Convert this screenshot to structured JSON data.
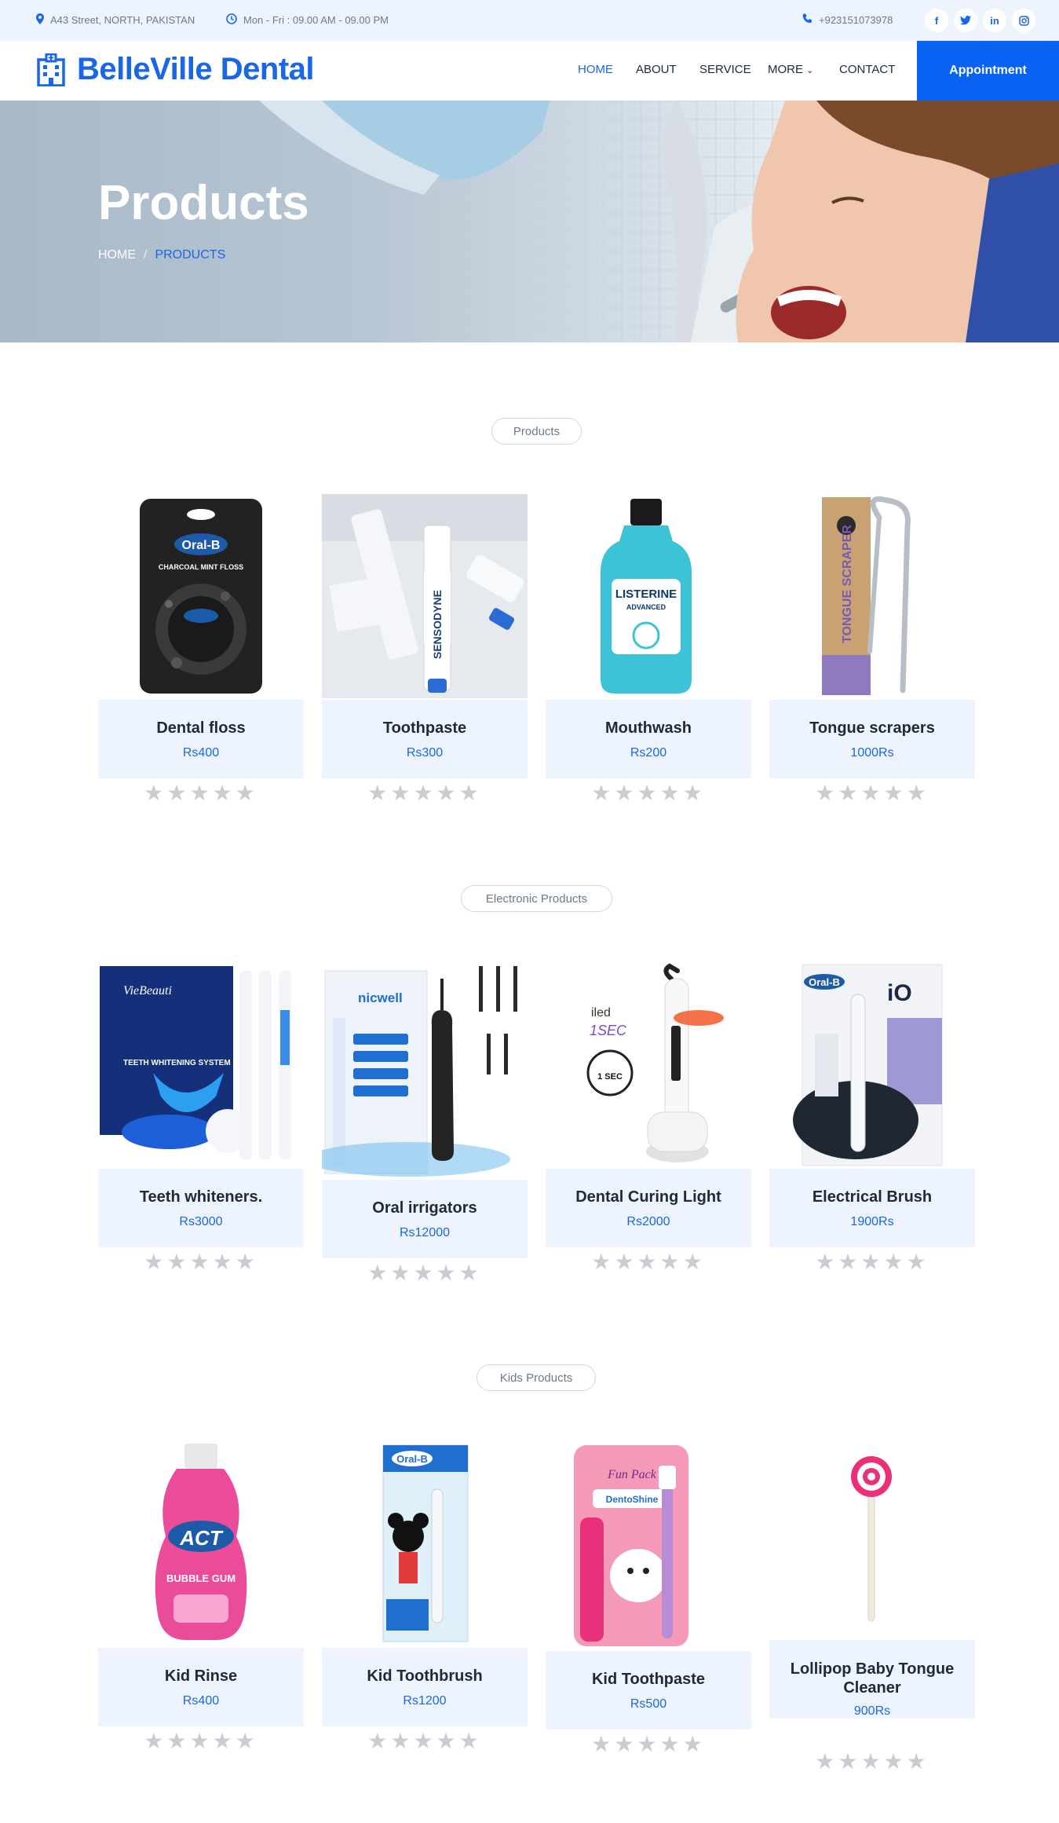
{
  "topbar": {
    "address": "A43 Street, NORTH, PAKISTAN",
    "hours": "Mon - Fri : 09.00 AM - 09.00 PM",
    "phone": "+923151073978",
    "socials": [
      "facebook-icon",
      "twitter-icon",
      "linkedin-icon",
      "instagram-icon"
    ]
  },
  "nav": {
    "brand": "BelleVille Dental",
    "items": [
      "HOME",
      "ABOUT",
      "SERVICE",
      "MORE",
      "CONTACT"
    ],
    "active": "HOME",
    "appointment": "Appointment"
  },
  "hero": {
    "title": "Products",
    "breadcrumb": [
      "HOME",
      "/",
      "PRODUCTS"
    ]
  },
  "sections": [
    {
      "label": "Products",
      "products": [
        {
          "name": "Dental floss",
          "price": "Rs400"
        },
        {
          "name": "Toothpaste",
          "price": "Rs300"
        },
        {
          "name": "Mouthwash",
          "price": "Rs200"
        },
        {
          "name": "Tongue scrapers",
          "price": "1000Rs"
        }
      ]
    },
    {
      "label": "Electronic Products",
      "products": [
        {
          "name": "Teeth whiteners.",
          "price": "Rs3000"
        },
        {
          "name": "Oral irrigators",
          "price": "Rs12000"
        },
        {
          "name": "Dental Curing Light",
          "price": "Rs2000"
        },
        {
          "name": "Electrical Brush",
          "price": "1900Rs"
        }
      ]
    },
    {
      "label": "Kids Products",
      "products": [
        {
          "name": "Kid Rinse",
          "price": "Rs400"
        },
        {
          "name": "Kid Toothbrush",
          "price": "Rs1200"
        },
        {
          "name": "Kid Toothpaste",
          "price": "Rs500"
        },
        {
          "name": "Lollipop Baby Tongue Cleaner",
          "price": "900Rs"
        }
      ]
    }
  ],
  "image_text": {
    "floss_brand": "Oral-B",
    "floss_line": "CHARCOAL MINT FLOSS",
    "toothpaste_brand": "SENSODYNE",
    "mouthwash_brand": "LISTERINE",
    "mouthwash_sub": "ADVANCED",
    "scraper_text": "TONGUE SCRAPER",
    "whitener_brand": "VieBeauti",
    "whitener_text": "TEETH WHITENING SYSTEM",
    "irrigator_brand": "nicwell",
    "curing_label": "iled",
    "curing_sec": "1SEC",
    "curing_badge": "1 SEC",
    "ebrush_brand": "Oral-B",
    "ebrush_model": "iO",
    "kidrinse_brand": "ACT",
    "kidrinse_flavor": "BUBBLE GUM",
    "kidbrush_brand": "Oral-B",
    "kidpaste_brand": "DentoShine",
    "kidpaste_tag": "Fun Pack"
  },
  "rating_stars": "★★★★★",
  "colors": {
    "accent": "#1967e6",
    "card_bg": "#eef4fd",
    "star": "#c9ccd1"
  }
}
